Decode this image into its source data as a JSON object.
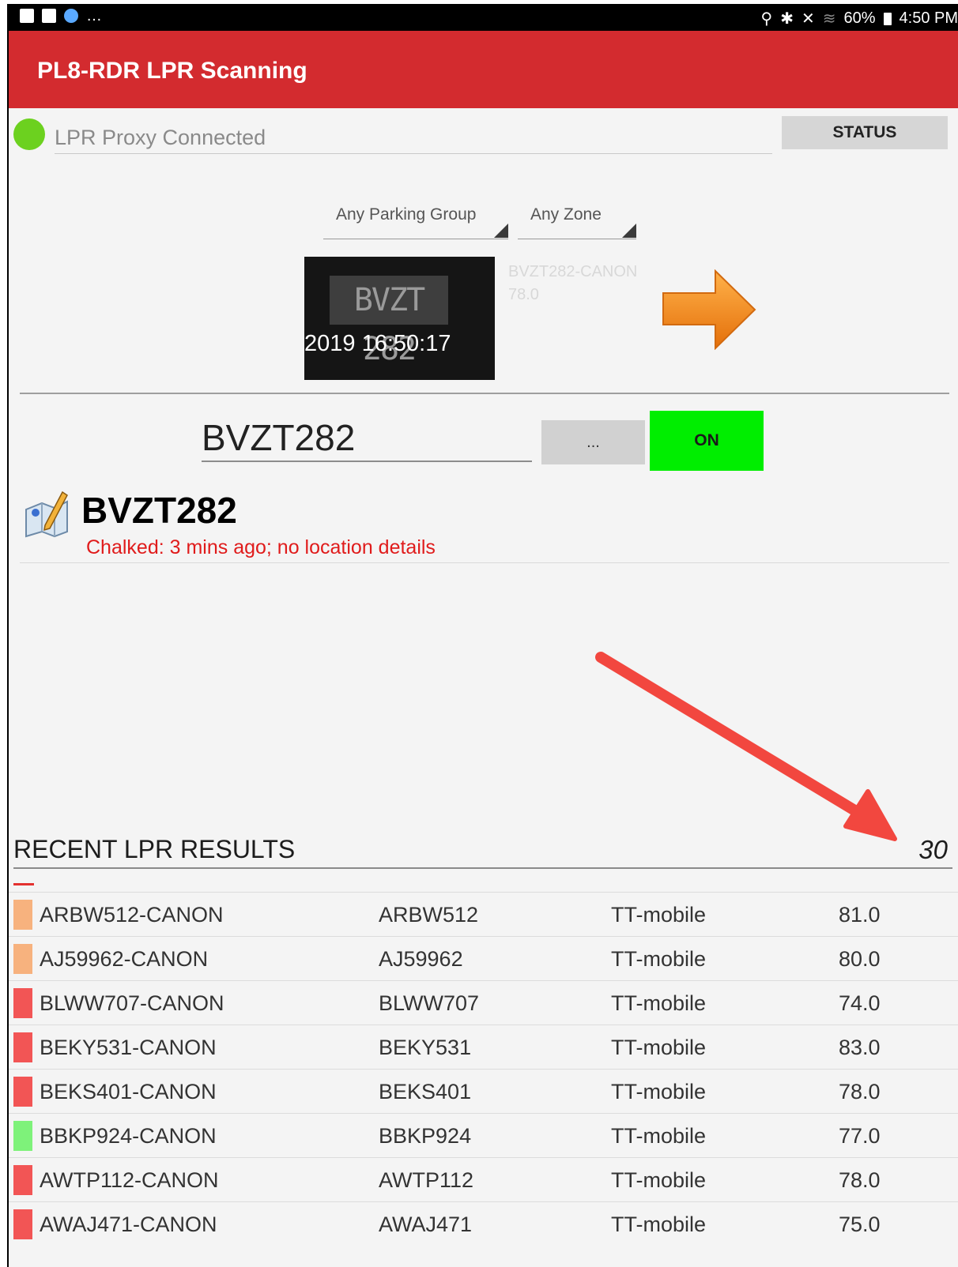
{
  "status_bar": {
    "left_icons": [
      "keyboard-icon",
      "image-icon",
      "info-icon"
    ],
    "left_overflow": "…",
    "right_icons": [
      "location-icon",
      "bluetooth-icon",
      "mute-icon",
      "wifi-icon"
    ],
    "battery": "60%",
    "time": "4:50 PM"
  },
  "app_bar": {
    "title": "PL8-RDR LPR Scanning"
  },
  "connection": {
    "status_text": "LPR Proxy Connected",
    "indicator_color": "#6cd11f",
    "status_button": "STATUS"
  },
  "filters": {
    "parking_group": "Any Parking Group",
    "zone": "Any Zone"
  },
  "last_read": {
    "plate_on_image": "BVZT 282",
    "image_timestamp": "2019 16:50:17",
    "read_id": "BVZT282-CANON",
    "confidence": "78.0"
  },
  "plate_entry": {
    "value": "BVZT282",
    "more_label": "...",
    "toggle_label": "ON",
    "toggle_color": "#00ee00"
  },
  "vehicle": {
    "plate": "BVZT282",
    "chalk_status": "Chalked: 3 mins ago; no location details"
  },
  "recent": {
    "title": "RECENT LPR RESULTS",
    "count": "30",
    "rows": [
      {
        "status_color": "#f7b27e",
        "read_id": "ARBW512-CANON",
        "plate": "ARBW512",
        "source": "TT-mobile",
        "confidence": "81.0"
      },
      {
        "status_color": "#f7b27e",
        "read_id": "AJ59962-CANON",
        "plate": "AJ59962",
        "source": "TT-mobile",
        "confidence": "80.0"
      },
      {
        "status_color": "#f25555",
        "read_id": "BLWW707-CANON",
        "plate": "BLWW707",
        "source": "TT-mobile",
        "confidence": "74.0"
      },
      {
        "status_color": "#f25555",
        "read_id": "BEKY531-CANON",
        "plate": "BEKY531",
        "source": "TT-mobile",
        "confidence": "83.0"
      },
      {
        "status_color": "#f25555",
        "read_id": "BEKS401-CANON",
        "plate": "BEKS401",
        "source": "TT-mobile",
        "confidence": "78.0"
      },
      {
        "status_color": "#7ef27a",
        "read_id": "BBKP924-CANON",
        "plate": "BBKP924",
        "source": "TT-mobile",
        "confidence": "77.0"
      },
      {
        "status_color": "#f25555",
        "read_id": "AWTP112-CANON",
        "plate": "AWTP112",
        "source": "TT-mobile",
        "confidence": "78.0"
      },
      {
        "status_color": "#f25555",
        "read_id": "AWAJ471-CANON",
        "plate": "AWAJ471",
        "source": "TT-mobile",
        "confidence": "75.0"
      }
    ]
  }
}
